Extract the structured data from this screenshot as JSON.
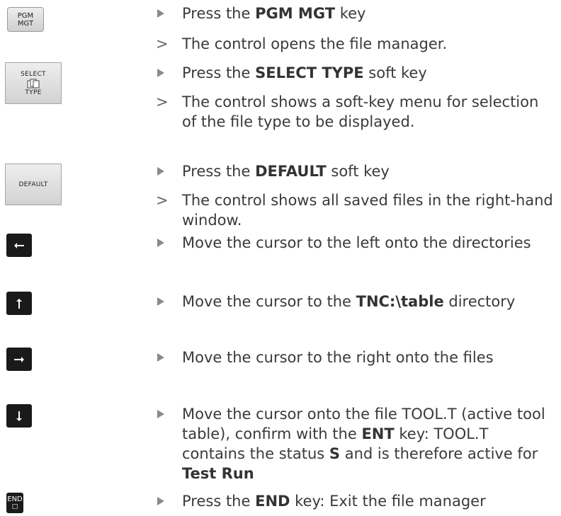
{
  "keys": {
    "pgm_mgt": {
      "line1": "PGM",
      "line2": "MGT"
    },
    "select_type": {
      "line1": "SELECT",
      "line2": "TYPE",
      "icon": "files-icon"
    },
    "default": {
      "label": "DEFAULT"
    },
    "left_arrow": {
      "glyph": "←",
      "icon": "arrow-left-icon"
    },
    "up_arrow": {
      "glyph": "↑",
      "icon": "arrow-up-icon"
    },
    "right_arrow": {
      "glyph": "→",
      "icon": "arrow-right-icon"
    },
    "down_arrow": {
      "glyph": "↓",
      "icon": "arrow-down-icon"
    },
    "end": {
      "label": "END",
      "glyph": "□"
    }
  },
  "steps": [
    {
      "pre": "Press the ",
      "bold": "PGM MGT",
      "post": " key"
    },
    {
      "text": "The control opens the file manager."
    },
    {
      "pre": "Press the ",
      "bold": "SELECT TYPE",
      "post": " soft key"
    },
    {
      "text": "The control shows a soft-key menu for selection of the file type to be displayed."
    },
    {
      "pre": "Press the ",
      "bold": "DEFAULT",
      "post": " soft key"
    },
    {
      "text": "The control shows all saved files in the right-hand window."
    },
    {
      "text": "Move the cursor to the left onto the directories"
    },
    {
      "pre": "Move the cursor to the ",
      "bold": "TNC:\\table",
      "post": " directory"
    },
    {
      "text": "Move the cursor to the right onto the files"
    },
    {
      "pre": "Move the cursor onto the file TOOL.T (active tool table), confirm with the ",
      "bold": "ENT",
      "post": " key: TOOL.T contains the status ",
      "bold2": "S",
      "post2": " and is therefore active for ",
      "bold3": "Test Run"
    },
    {
      "pre": "Press the ",
      "bold": "END",
      "post": " key: Exit the file manager"
    }
  ],
  "markers": {
    "action": "▶",
    "result": ">"
  }
}
